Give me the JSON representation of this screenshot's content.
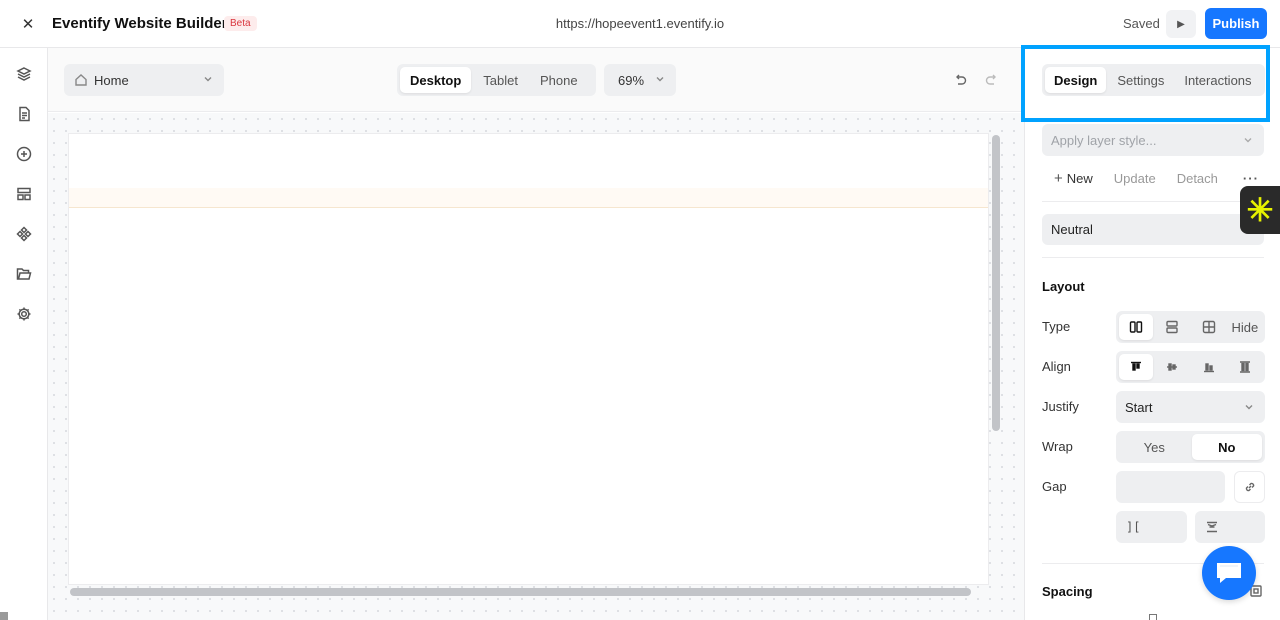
{
  "header": {
    "close_icon": "close-icon",
    "title": "Eventify Website Builder",
    "badge": "Beta",
    "url": "https://hopeevent1.eventify.io",
    "status": "Saved",
    "preview_icon": "play-icon",
    "publish_label": "Publish",
    "accent_color": "#1677ff"
  },
  "rail": {
    "items": [
      {
        "icon": "layers-icon"
      },
      {
        "icon": "page-icon"
      },
      {
        "icon": "add-circle-icon"
      },
      {
        "icon": "layout-icon"
      },
      {
        "icon": "components-icon"
      },
      {
        "icon": "folder-icon"
      },
      {
        "icon": "settings-gear-icon"
      }
    ]
  },
  "toolbar": {
    "page_select": "Home",
    "devices": [
      {
        "label": "Desktop",
        "active": true
      },
      {
        "label": "Tablet",
        "active": false
      },
      {
        "label": "Phone",
        "active": false
      }
    ],
    "zoom": "69%",
    "undo_icon": "undo-icon",
    "redo_icon": "redo-icon"
  },
  "panel": {
    "tabs": [
      {
        "label": "Design",
        "active": true
      },
      {
        "label": "Settings",
        "active": false
      },
      {
        "label": "Interactions",
        "active": false
      }
    ],
    "highlight_color": "#00a2ff",
    "layer_style_placeholder": "Apply layer style...",
    "style_actions": {
      "new": "New",
      "update": "Update",
      "detach": "Detach",
      "more": "···"
    },
    "neutral_value": "Neutral",
    "layout": {
      "title": "Layout",
      "type_label": "Type",
      "type_options": [
        {
          "icon": "columns-icon",
          "active": true
        },
        {
          "icon": "rows-icon",
          "active": false
        },
        {
          "icon": "grid-icon",
          "active": false
        },
        {
          "label": "Hide",
          "active": false
        }
      ],
      "align_label": "Align",
      "align_options": [
        {
          "icon": "align-top-icon",
          "active": true
        },
        {
          "icon": "align-center-icon",
          "active": false
        },
        {
          "icon": "align-bottom-icon",
          "active": false
        },
        {
          "icon": "align-stretch-icon",
          "active": false
        }
      ],
      "justify_label": "Justify",
      "justify_value": "Start",
      "wrap_label": "Wrap",
      "wrap_options": [
        {
          "label": "Yes",
          "active": false
        },
        {
          "label": "No",
          "active": true
        }
      ],
      "gap_label": "Gap",
      "gap_column_glyph": "][",
      "link_icon": "link-icon",
      "row_gap_icon": "row-gap-icon"
    },
    "spacing": {
      "title": "Spacing"
    }
  },
  "widgets": {
    "asterisk": "✳",
    "chat_icon": "chat-icon"
  }
}
